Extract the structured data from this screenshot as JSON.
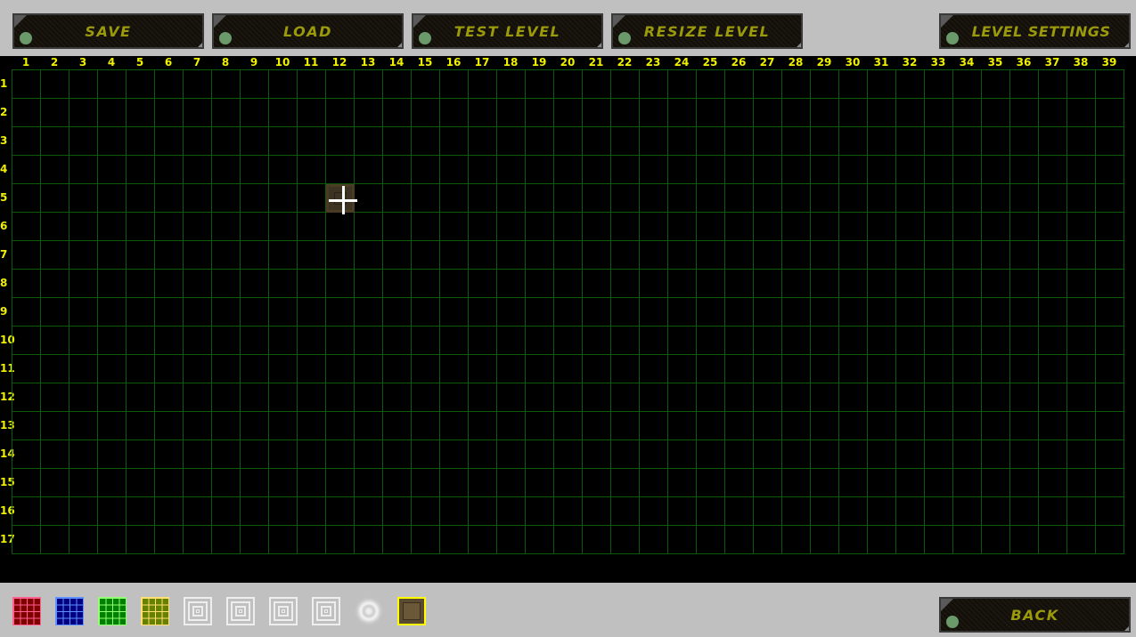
{
  "toolbar": {
    "save": "SAVE",
    "load": "LOAD",
    "test": "TEST LEVEL",
    "resize": "RESIZE LEVEL",
    "settings": "LEVEL SETTINGS",
    "back": "BACK"
  },
  "grid": {
    "columns": [
      "1",
      "2",
      "3",
      "4",
      "5",
      "6",
      "7",
      "8",
      "9",
      "10",
      "11",
      "12",
      "13",
      "14",
      "15",
      "16",
      "17",
      "18",
      "19",
      "20",
      "21",
      "22",
      "23",
      "24",
      "25",
      "26",
      "27",
      "28",
      "29",
      "30",
      "31",
      "32",
      "33",
      "34",
      "35",
      "36",
      "37",
      "38",
      "39"
    ],
    "rows": [
      "1",
      "2",
      "3",
      "4",
      "5",
      "6",
      "7",
      "8",
      "9",
      "10",
      "11",
      "12",
      "13",
      "14",
      "15",
      "16",
      "17"
    ],
    "placed_tiles": [
      {
        "col": 12,
        "row": 5,
        "type": "metal-crate"
      }
    ],
    "cursor": {
      "col": 12,
      "row": 5
    },
    "line_color": "#0b5a0b",
    "label_color": "#f0f000"
  },
  "palette": [
    {
      "type": "red-grid",
      "fill": "#800000",
      "line": "#ff6090"
    },
    {
      "type": "blue-grid",
      "fill": "#000080",
      "line": "#6090ff"
    },
    {
      "type": "green-grid",
      "fill": "#008000",
      "line": "#90ff70"
    },
    {
      "type": "olive-grid",
      "fill": "#668000",
      "line": "#ffe070"
    },
    {
      "type": "concentric-square-1"
    },
    {
      "type": "concentric-square-2"
    },
    {
      "type": "concentric-square-3"
    },
    {
      "type": "concentric-square-4"
    },
    {
      "type": "swirl-portal"
    },
    {
      "type": "metal-crate",
      "selected": true
    }
  ]
}
